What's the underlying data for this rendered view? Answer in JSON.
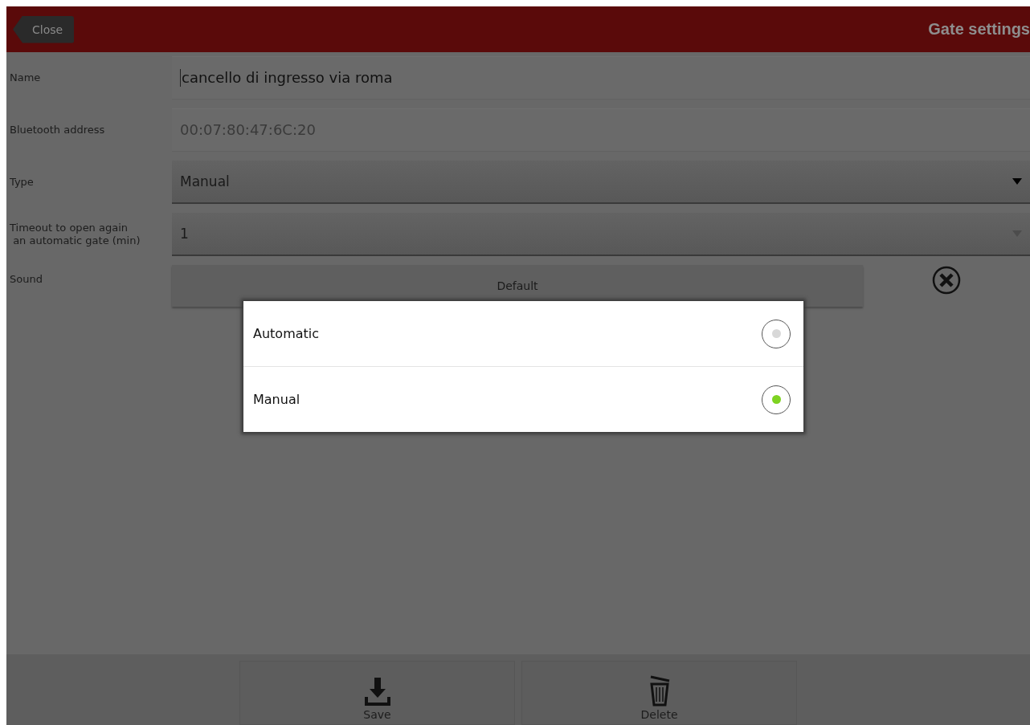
{
  "header": {
    "close_button": "Close",
    "title": "Gate settings"
  },
  "fields": [
    {
      "kind": "text",
      "label": "Name",
      "value": "cancello di ingresso via roma",
      "disabled": false
    },
    {
      "kind": "text",
      "label": "Bluetooth address",
      "value": "00:07:80:47:6C:20",
      "disabled": true
    },
    {
      "kind": "dropdown",
      "label": "Type",
      "value": "Manual",
      "disabled": false
    },
    {
      "kind": "dropdown",
      "label": "Timeout to open again\n an automatic gate (min)",
      "value": "1",
      "disabled": true
    },
    {
      "kind": "button",
      "label": "Sound",
      "value": "Default",
      "disabled": false
    }
  ],
  "dialog": {
    "options": [
      {
        "label": "Automatic",
        "selected": false
      },
      {
        "label": "Manual",
        "selected": true
      }
    ]
  },
  "footer": {
    "buttons": [
      {
        "kind": "save",
        "label": "Save"
      },
      {
        "kind": "delete",
        "label": "Delete"
      }
    ]
  }
}
